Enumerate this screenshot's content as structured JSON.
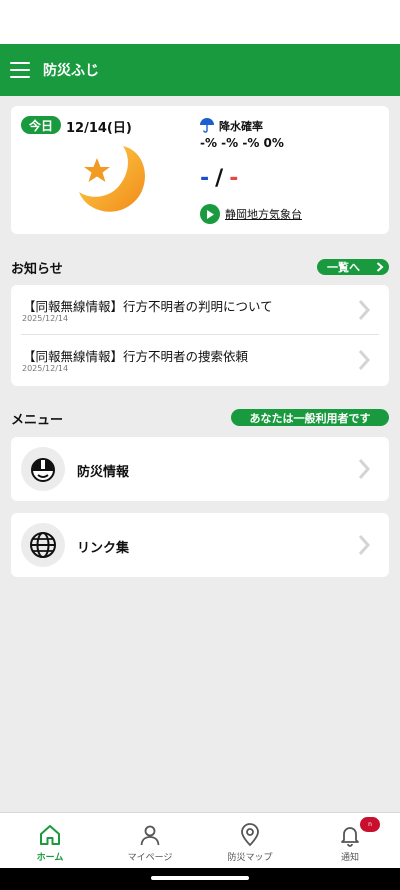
{
  "app": {
    "title": "防災ふじ"
  },
  "weather": {
    "today_label": "今日",
    "date": "12/14(日)",
    "rain_label": "降水確率",
    "rain_values": "-% -% -% 0%",
    "temp_high": "-",
    "temp_separator": "/",
    "temp_low": "-",
    "source": "静岡地方気象台",
    "icon": "crescent-moon-star-icon"
  },
  "news": {
    "section_title": "お知らせ",
    "view_all_label": "一覧へ",
    "items": [
      {
        "title": "【同報無線情報】行方不明者の判明について",
        "date": "2025/12/14"
      },
      {
        "title": "【同報無線情報】行方不明者の捜索依頼",
        "date": "2025/12/14"
      }
    ]
  },
  "menu": {
    "section_title": "メニュー",
    "user_status": "あなたは一般利用者です",
    "items": [
      {
        "label": "防災情報",
        "icon": "helmet-icon"
      },
      {
        "label": "リンク集",
        "icon": "globe-icon"
      }
    ]
  },
  "bottom_nav": {
    "items": [
      {
        "label": "ホーム",
        "icon": "home-icon",
        "active": true
      },
      {
        "label": "マイページ",
        "icon": "person-icon"
      },
      {
        "label": "防災マップ",
        "icon": "map-pin-icon"
      },
      {
        "label": "通知",
        "icon": "bell-icon",
        "badge": "n"
      }
    ]
  },
  "colors": {
    "brand": "#1a9a3f",
    "background": "#ececec",
    "badge": "#c8102e",
    "temp_high": "#1b4fd1",
    "temp_low": "#e24a4a"
  }
}
